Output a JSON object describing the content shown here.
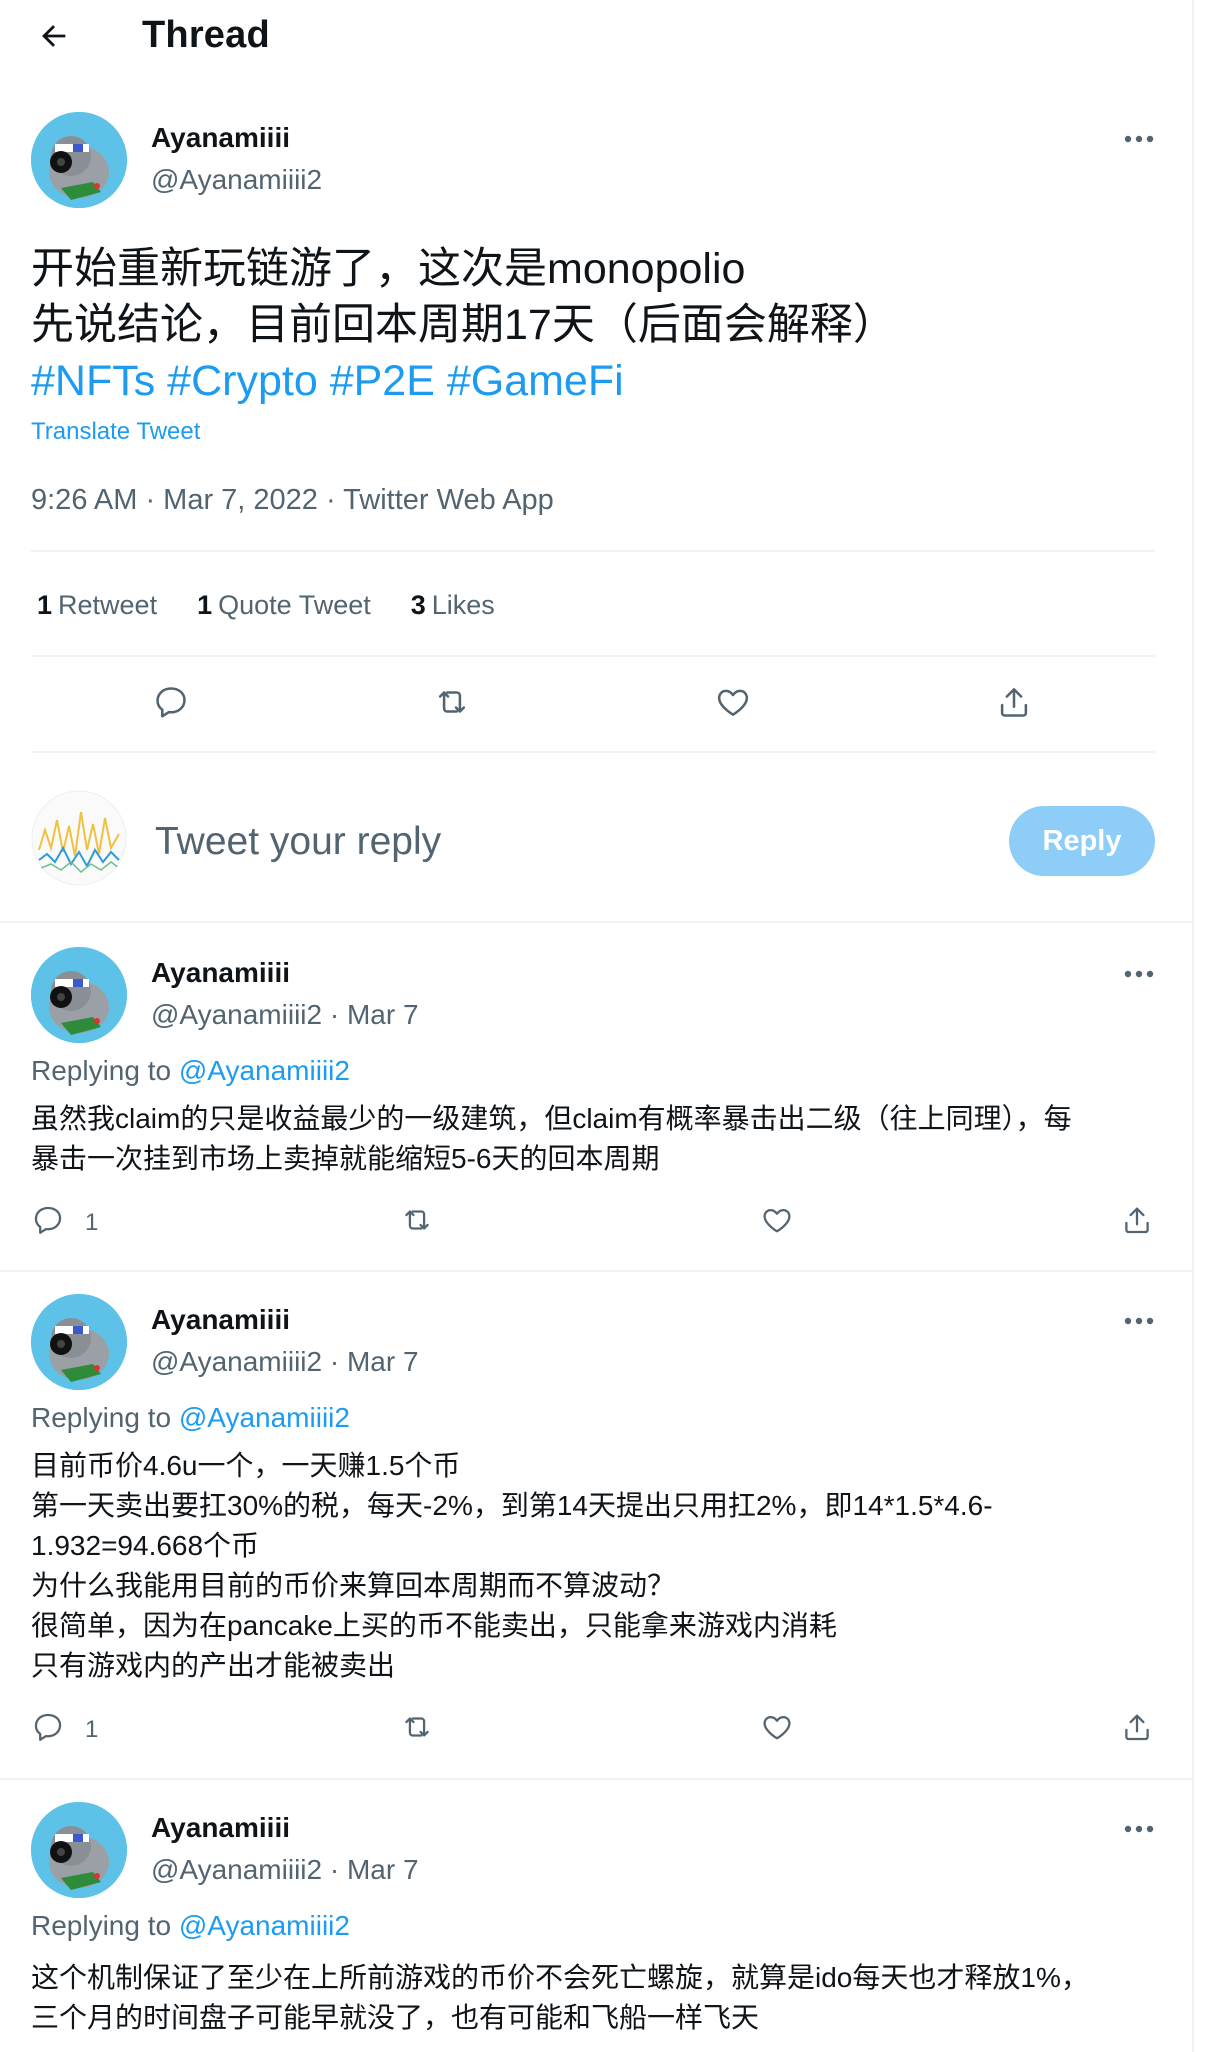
{
  "header": {
    "title": "Thread"
  },
  "main_tweet": {
    "name": "Ayanamiiii",
    "handle": "@Ayanamiiii2",
    "text_line1": "开始重新玩链游了，这次是monopolio",
    "text_line2": "先说结论，目前回本周期17天（后面会解释）",
    "hashtags": "#NFTs #Crypto #P2E #GameFi",
    "translate": "Translate Tweet",
    "meta": "9:26 AM · Mar 7, 2022 · Twitter Web App",
    "stats": [
      {
        "count": "1",
        "label": "Retweet"
      },
      {
        "count": "1",
        "label": "Quote Tweet"
      },
      {
        "count": "3",
        "label": "Likes"
      }
    ]
  },
  "composer": {
    "placeholder": "Tweet your reply",
    "button": "Reply"
  },
  "replies": [
    {
      "name": "Ayanamiiii",
      "handle_date": "@Ayanamiiii2 · Mar 7",
      "replying_prefix": "Replying to ",
      "replying_to": "@Ayanamiiii2",
      "lines": [
        "虽然我claim的只是收益最少的一级建筑，但claim有概率暴击出二级（往上同理），每",
        "暴击一次挂到市场上卖掉就能缩短5-6天的回本周期"
      ],
      "reply_count": "1"
    },
    {
      "name": "Ayanamiiii",
      "handle_date": "@Ayanamiiii2 · Mar 7",
      "replying_prefix": "Replying to ",
      "replying_to": "@Ayanamiiii2",
      "lines": [
        "目前币价4.6u一个，一天赚1.5个币",
        "第一天卖出要扛30%的税，每天-2%，到第14天提出只用扛2%，即14*1.5*4.6-",
        "1.932=94.668个币",
        "为什么我能用目前的币价来算回本周期而不算波动？",
        "很简单，因为在pancake上买的币不能卖出，只能拿来游戏内消耗",
        "只有游戏内的产出才能被卖出"
      ],
      "reply_count": "1"
    },
    {
      "name": "Ayanamiiii",
      "handle_date": "@Ayanamiiii2 · Mar 7",
      "replying_prefix": "Replying to ",
      "replying_to": "@Ayanamiiii2",
      "lines": [
        "这个机制保证了至少在上所前游戏的币价不会死亡螺旋，就算是ido每天也才释放1%，",
        "三个月的时间盘子可能早就没了，也有可能和飞船一样飞天"
      ]
    }
  ],
  "colors": {
    "accent": "#1d9bf0",
    "secondary_text": "#536471",
    "divider": "#eff3f4",
    "reply_button": "#8ecdf8"
  }
}
